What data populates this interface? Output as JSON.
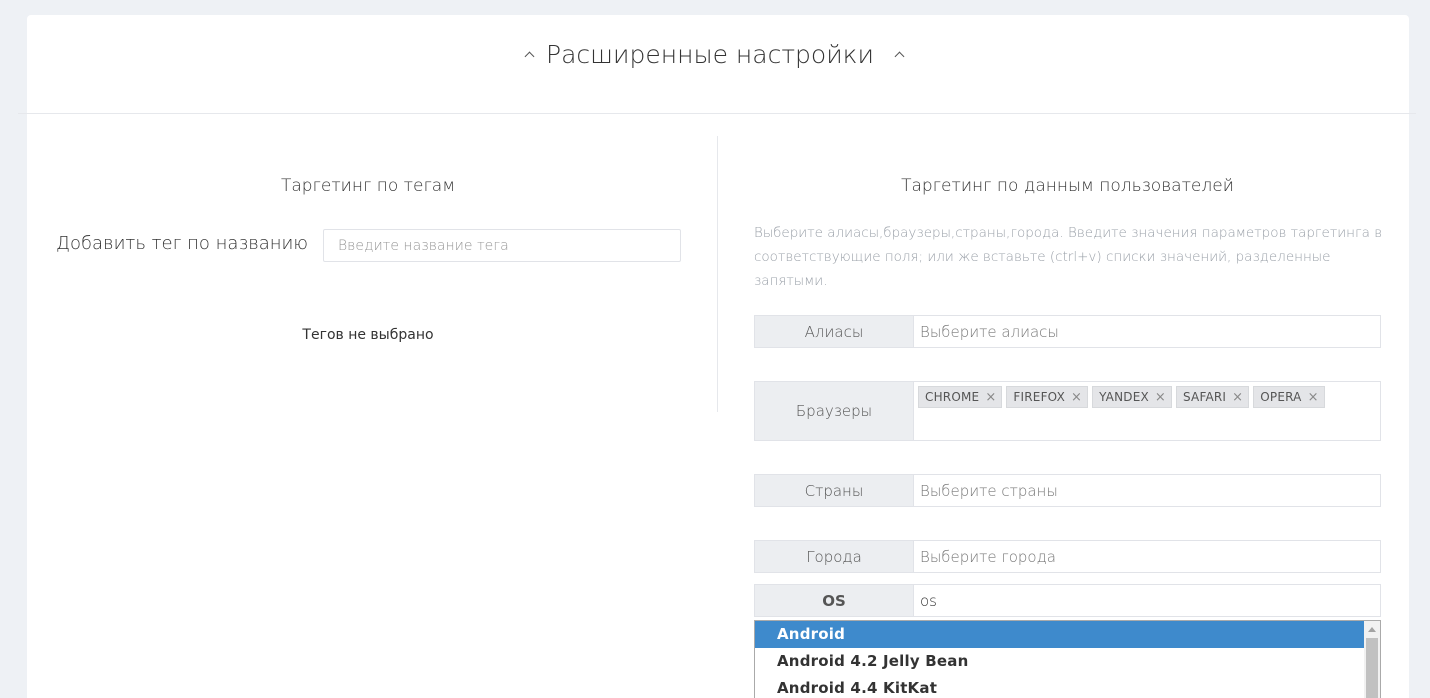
{
  "header": {
    "title": "Расширенные настройки"
  },
  "tags_section": {
    "heading": "Таргетинг по тегам",
    "add_label": "Добавить тег по названию",
    "input_placeholder": "Введите название тега",
    "empty_text": "Тегов не выбрано"
  },
  "user_section": {
    "heading": "Таргетинг по данным пользователей",
    "hint": "Выберите алиасы,браузеры,страны,города. Введите значения параметров таргетинга в соответствующие поля; или же вставьте (ctrl+v) списки значений, разделенные запятыми.",
    "aliases": {
      "label": "Алиасы",
      "placeholder": "Выберите алиасы"
    },
    "browsers": {
      "label": "Браузеры",
      "selected": [
        "CHROME",
        "FIREFOX",
        "YANDEX",
        "SAFARI",
        "OPERA"
      ],
      "remove_glyph": "×"
    },
    "countries": {
      "label": "Страны",
      "placeholder": "Выберите страны"
    },
    "cities": {
      "label": "Города",
      "placeholder": "Выберите города"
    },
    "os": {
      "label": "OS",
      "value": "os",
      "options": [
        "Android",
        "Android 4.2 Jelly Bean",
        "Android 4.4 KitKat"
      ],
      "highlighted": "Android"
    }
  },
  "colors": {
    "highlight": "#3e8acc",
    "background": "#eef1f5",
    "label_bg": "#eceef1"
  },
  "icons": {
    "title_left": "chevron-up-icon",
    "title_right": "chevron-up-icon",
    "chip_remove": "close-icon"
  }
}
